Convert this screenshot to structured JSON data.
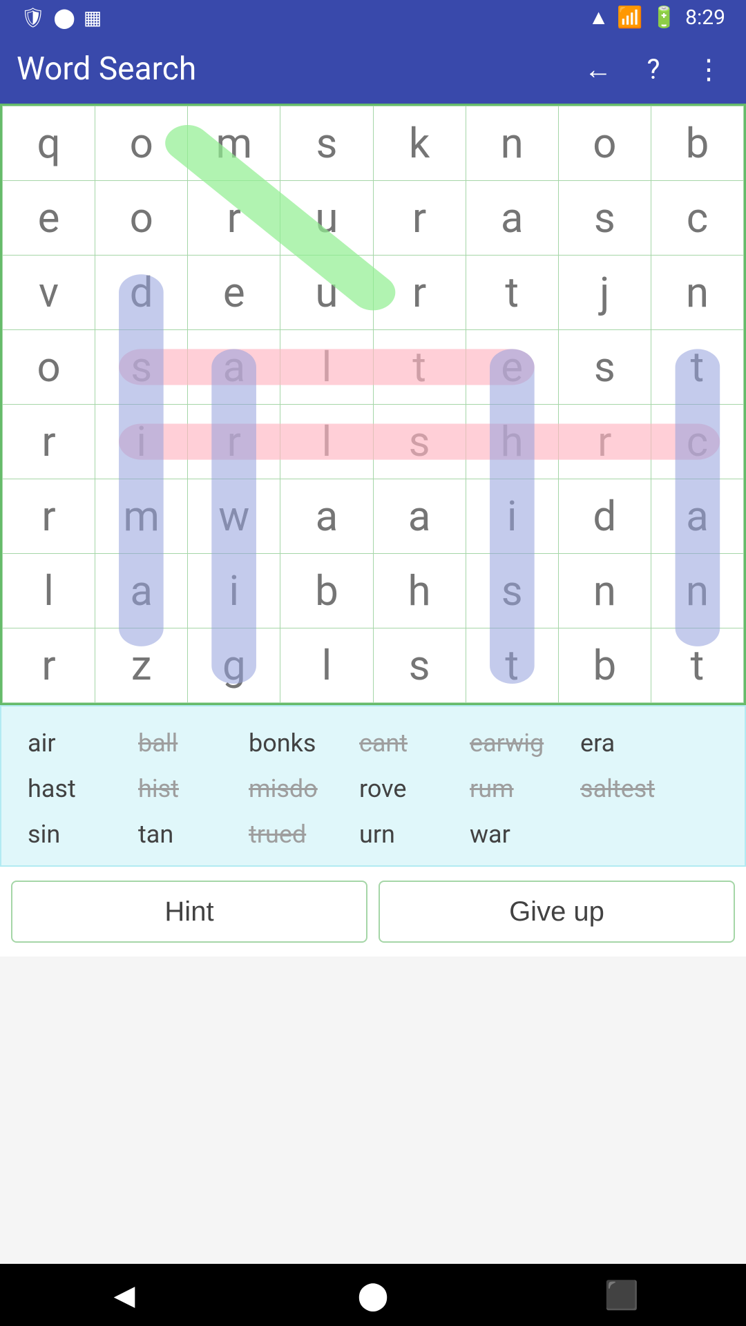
{
  "app": {
    "title": "Word Search",
    "status_time": "8:29"
  },
  "grid": {
    "rows": [
      [
        "q",
        "o",
        "m",
        "s",
        "k",
        "n",
        "o",
        "b"
      ],
      [
        "e",
        "o",
        "r",
        "u",
        "r",
        "a",
        "s",
        "c"
      ],
      [
        "v",
        "d",
        "e",
        "u",
        "r",
        "t",
        "j",
        "n"
      ],
      [
        "o",
        "s",
        "a",
        "l",
        "t",
        "e",
        "s",
        "t"
      ],
      [
        "r",
        "i",
        "r",
        "l",
        "s",
        "h",
        "r",
        "c"
      ],
      [
        "r",
        "m",
        "w",
        "a",
        "a",
        "i",
        "d",
        "a"
      ],
      [
        "l",
        "a",
        "i",
        "b",
        "h",
        "s",
        "n",
        "n"
      ],
      [
        "r",
        "z",
        "g",
        "l",
        "s",
        "t",
        "b",
        "t"
      ]
    ]
  },
  "words": [
    {
      "text": "air",
      "strikethrough": false
    },
    {
      "text": "ball",
      "strikethrough": true
    },
    {
      "text": "bonks",
      "strikethrough": false
    },
    {
      "text": "cant",
      "strikethrough": true
    },
    {
      "text": "earwig",
      "strikethrough": true
    },
    {
      "text": "era",
      "strikethrough": false
    },
    {
      "text": "hast",
      "strikethrough": false
    },
    {
      "text": "hist",
      "strikethrough": true
    },
    {
      "text": "misdo",
      "strikethrough": true
    },
    {
      "text": "rove",
      "strikethrough": false
    },
    {
      "text": "rum",
      "strikethrough": true
    },
    {
      "text": "saltest",
      "strikethrough": true
    },
    {
      "text": "sin",
      "strikethrough": false
    },
    {
      "text": "tan",
      "strikethrough": false
    },
    {
      "text": "trued",
      "strikethrough": true
    },
    {
      "text": "urn",
      "strikethrough": false
    },
    {
      "text": "war",
      "strikethrough": false
    }
  ],
  "buttons": {
    "hint": "Hint",
    "give_up": "Give up"
  },
  "highlights": {
    "blue_col1_rows": [
      1,
      2,
      3,
      4,
      5,
      6
    ],
    "blue_col2_rows": [
      2,
      3,
      4,
      5,
      6
    ],
    "blue_col7_rows": [
      3,
      4,
      5,
      6
    ],
    "blue_col5_rows": [
      3,
      4,
      5,
      6,
      7
    ],
    "pink_row2": true,
    "pink_row3": true
  }
}
